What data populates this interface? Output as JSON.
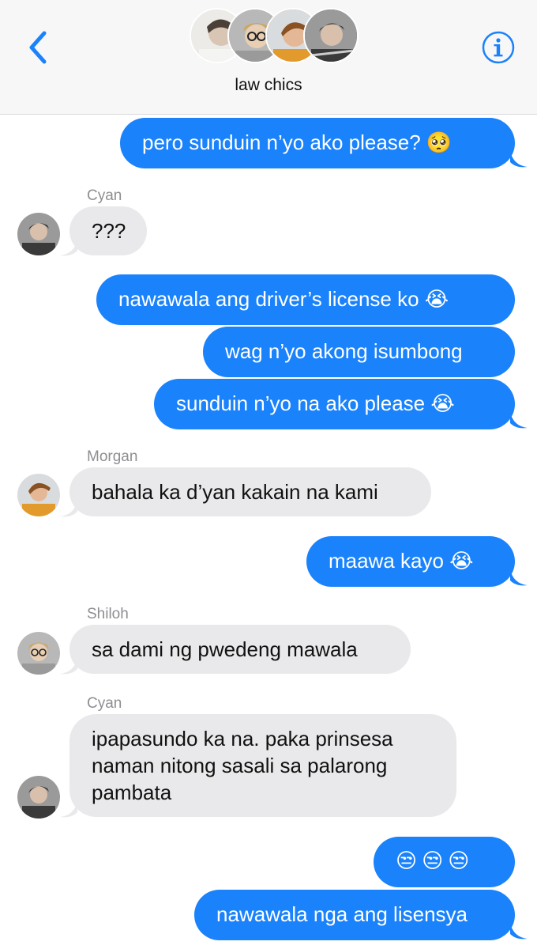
{
  "header": {
    "group_name": "law chics",
    "back_icon": "chevron-left-icon",
    "info_icon": "info-icon",
    "accent": "#1a82fb"
  },
  "messages": [
    {
      "dir": "sent",
      "text": "pero sunduin n’yo ako please? 🥺"
    },
    {
      "dir": "recv",
      "sender": "Cyan",
      "text": "???"
    },
    {
      "dir": "sent",
      "text": "nawawala ang driver’s license ko 😭"
    },
    {
      "dir": "sent",
      "text": "wag n’yo akong isumbong"
    },
    {
      "dir": "sent",
      "text": "sunduin n’yo na ako please 😭"
    },
    {
      "dir": "recv",
      "sender": "Morgan",
      "text": "bahala ka d’yan kakain na kami"
    },
    {
      "dir": "sent",
      "text": "maawa kayo 😭"
    },
    {
      "dir": "recv",
      "sender": "Shiloh",
      "text": "sa dami ng pwedeng mawala"
    },
    {
      "dir": "recv",
      "sender": "Cyan",
      "lines": [
        "ipapasundo ka na. paka prinsesa",
        "naman nitong sasali sa palarong",
        "pambata"
      ]
    },
    {
      "dir": "sent",
      "text": "😒😒😒"
    },
    {
      "dir": "sent",
      "text": "nawawala nga ang lisensya"
    }
  ]
}
